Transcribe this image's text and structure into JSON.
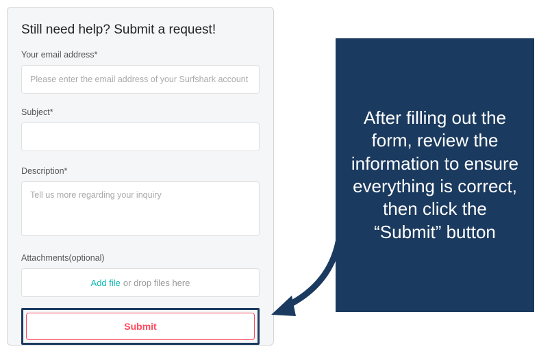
{
  "form": {
    "title": "Still need help? Submit a request!",
    "email": {
      "label": "Your email address*",
      "placeholder": "Please enter the email address of your Surfshark account"
    },
    "subject": {
      "label": "Subject*"
    },
    "description": {
      "label": "Description*",
      "placeholder": "Tell us more regarding your inquiry"
    },
    "attachments": {
      "label": "Attachments(optional)",
      "add_link": "Add file",
      "drop_text": " or drop files here"
    },
    "submit_label": "Submit"
  },
  "callout": {
    "text": "After filling out the form, review the information to ensure everything is correct, then click the “Submit” button"
  },
  "colors": {
    "accent_navy": "#1b3a5f",
    "accent_red": "#ff4a5e",
    "accent_teal": "#0fbab5"
  }
}
